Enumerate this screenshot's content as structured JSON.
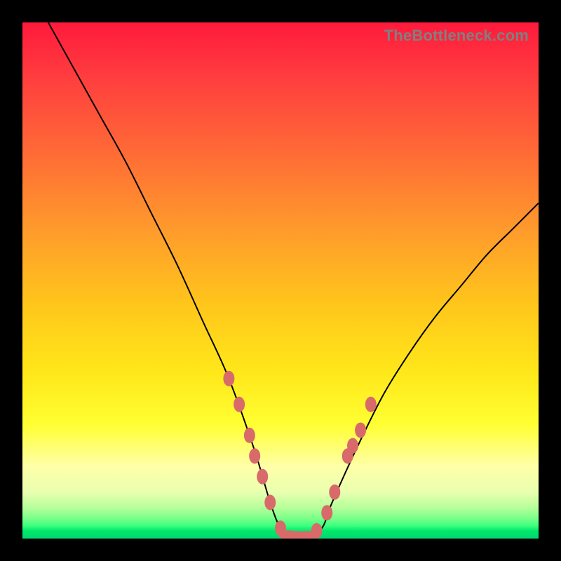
{
  "watermark": "TheBottleneck.com",
  "chart_data": {
    "type": "line",
    "title": "",
    "xlabel": "",
    "ylabel": "",
    "xlim": [
      0,
      100
    ],
    "ylim": [
      0,
      100
    ],
    "curve": {
      "x": [
        5,
        10,
        15,
        20,
        25,
        30,
        35,
        40,
        45,
        48,
        50,
        52,
        55,
        58,
        60,
        65,
        70,
        75,
        80,
        85,
        90,
        95,
        100
      ],
      "y": [
        100,
        91,
        82,
        73,
        63,
        53,
        42,
        31,
        17,
        7,
        2,
        0.5,
        0.5,
        2,
        7,
        18,
        28,
        36,
        43,
        49,
        55,
        60,
        65
      ]
    },
    "markers": [
      {
        "x": 40,
        "y": 31
      },
      {
        "x": 42,
        "y": 26
      },
      {
        "x": 44,
        "y": 20
      },
      {
        "x": 45,
        "y": 16
      },
      {
        "x": 46.5,
        "y": 12
      },
      {
        "x": 48,
        "y": 7
      },
      {
        "x": 50,
        "y": 2
      },
      {
        "x": 51.5,
        "y": 0.7
      },
      {
        "x": 53,
        "y": 0.6
      },
      {
        "x": 55,
        "y": 0.6
      },
      {
        "x": 57,
        "y": 1.5
      },
      {
        "x": 59,
        "y": 5
      },
      {
        "x": 60.5,
        "y": 9
      },
      {
        "x": 63,
        "y": 16
      },
      {
        "x": 64,
        "y": 18
      },
      {
        "x": 65.5,
        "y": 21
      },
      {
        "x": 67.5,
        "y": 26
      }
    ]
  }
}
